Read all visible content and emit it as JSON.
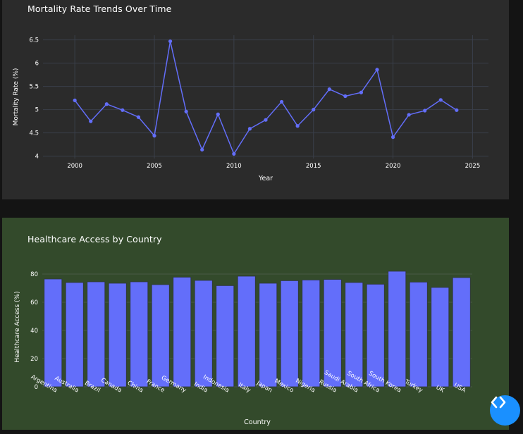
{
  "charts": {
    "line": {
      "chart_data": {
        "type": "line",
        "title": "Mortality Rate Trends Over Time",
        "xlabel": "Year",
        "ylabel": "Mortality Rate (%)",
        "x": [
          2000,
          2001,
          2002,
          2003,
          2004,
          2005,
          2006,
          2007,
          2008,
          2009,
          2010,
          2011,
          2012,
          2013,
          2014,
          2015,
          2016,
          2017,
          2018,
          2019,
          2020,
          2021,
          2022,
          2023,
          2024
        ],
        "y": [
          5.2,
          4.75,
          5.12,
          4.99,
          4.84,
          4.44,
          6.47,
          4.96,
          4.14,
          4.9,
          4.05,
          4.59,
          4.78,
          5.17,
          4.65,
          5.0,
          5.44,
          5.29,
          5.37,
          5.86,
          4.41,
          4.89,
          4.98,
          5.21,
          4.99
        ],
        "xlim": [
          1998,
          2026
        ],
        "ylim": [
          3.95,
          6.6
        ],
        "xticks": [
          2000,
          2005,
          2010,
          2015,
          2020,
          2025
        ],
        "yticks": [
          "4",
          "4.5",
          "5",
          "5.5",
          "6",
          "6.5"
        ],
        "ytick_values": [
          4,
          4.5,
          5,
          5.5,
          6,
          6.5
        ],
        "grid": true,
        "colors": {
          "line": "#636efa",
          "grid": "#3a3f4a",
          "text": "#ffffff"
        }
      }
    },
    "bar": {
      "chart_data": {
        "type": "bar",
        "title": "Healthcare Access by Country",
        "xlabel": "Country",
        "ylabel": "Healthcare Access (%)",
        "categories": [
          "Argentina",
          "Australia",
          "Brazil",
          "Canada",
          "China",
          "France",
          "Germany",
          "India",
          "Indonesia",
          "Italy",
          "Japan",
          "Mexico",
          "Nigeria",
          "Russia",
          "Saudi Arabia",
          "South Africa",
          "South Korea",
          "Turkey",
          "UK",
          "USA"
        ],
        "values": [
          76.5,
          74.0,
          74.5,
          73.5,
          74.5,
          72.5,
          77.8,
          75.5,
          71.8,
          78.5,
          73.5,
          75.3,
          75.8,
          76.2,
          74.0,
          72.8,
          82.0,
          74.3,
          70.5,
          77.5
        ],
        "ylim": [
          0,
          85
        ],
        "yticks": [
          "0",
          "20",
          "40",
          "60",
          "80"
        ],
        "ytick_values": [
          0,
          20,
          40,
          60,
          80
        ],
        "grid": true,
        "colors": {
          "bar": "#636efa",
          "bar_edge": "#2f3640",
          "grid": "#4a5a45",
          "text": "#ffffff"
        }
      }
    }
  },
  "fab": {
    "icon": "code-arrows-icon",
    "color": "#1a90ff"
  }
}
